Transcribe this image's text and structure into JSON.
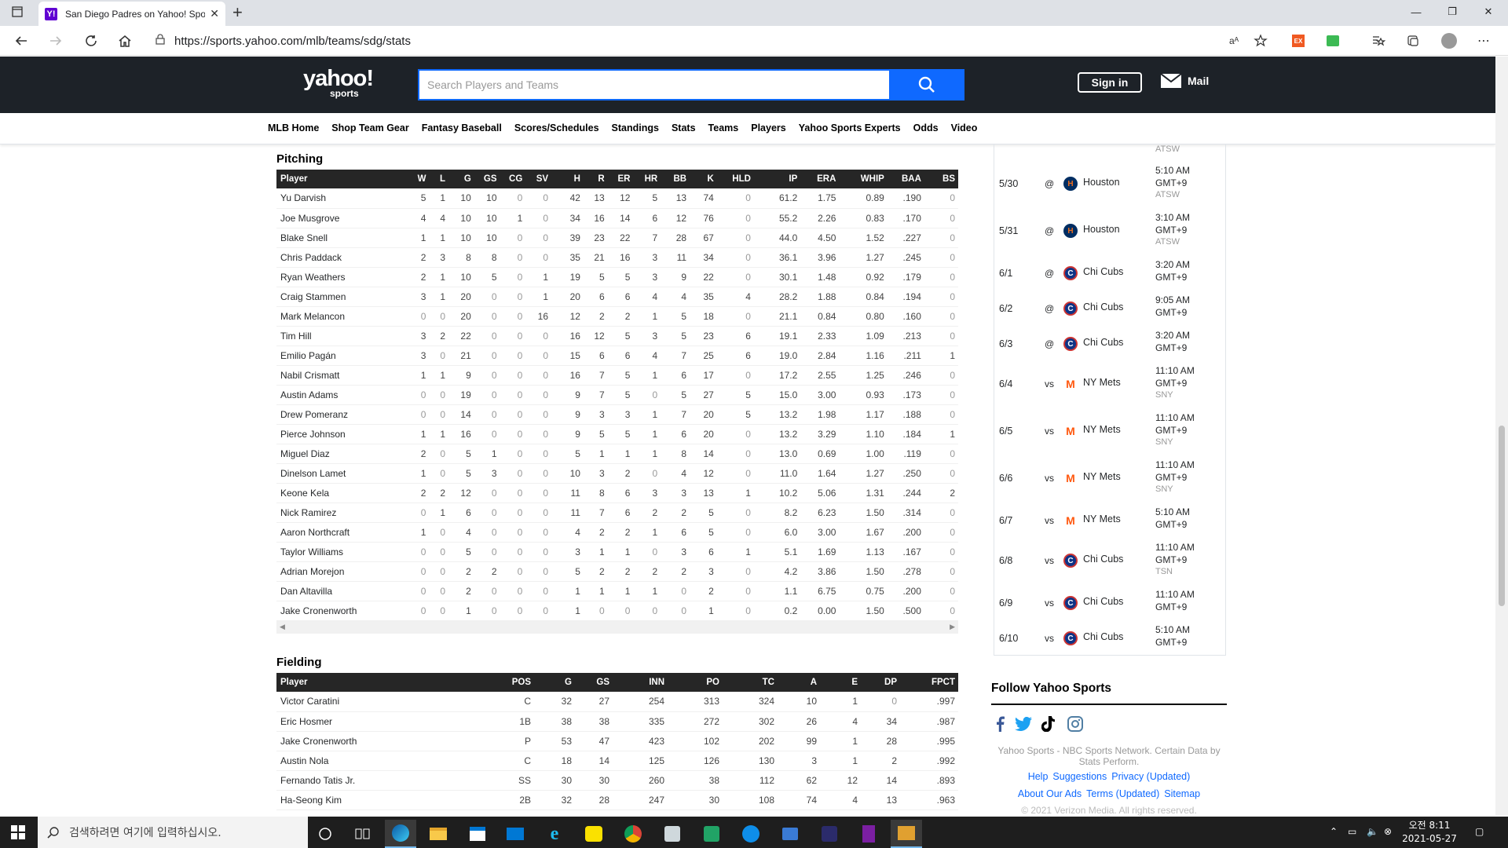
{
  "browser": {
    "tab_title": "San Diego Padres on Yahoo! Spo",
    "url": "https://sports.yahoo.com/mlb/teams/sdg/stats",
    "ext_label": "EX",
    "reader_label": "aᴬ"
  },
  "yahoo": {
    "logo_main": "yahoo!",
    "logo_sub": "sports",
    "search_placeholder": "Search Players and Teams",
    "sign_in": "Sign in",
    "mail": "Mail",
    "nav": [
      "MLB Home",
      "Shop Team Gear",
      "Fantasy Baseball",
      "Scores/Schedules",
      "Standings",
      "Stats",
      "Teams",
      "Players",
      "Yahoo Sports Experts",
      "Odds",
      "Video"
    ]
  },
  "pitching": {
    "title": "Pitching",
    "headers": [
      "Player",
      "W",
      "L",
      "G",
      "GS",
      "CG",
      "SV",
      "H",
      "R",
      "ER",
      "HR",
      "BB",
      "K",
      "HLD",
      "IP",
      "ERA",
      "WHIP",
      "BAA",
      "BS"
    ],
    "rows": [
      [
        "Yu Darvish",
        "5",
        "1",
        "10",
        "10",
        "0",
        "0",
        "42",
        "13",
        "12",
        "5",
        "13",
        "74",
        "0",
        "61.2",
        "1.75",
        "0.89",
        ".190",
        "0"
      ],
      [
        "Joe Musgrove",
        "4",
        "4",
        "10",
        "10",
        "1",
        "0",
        "34",
        "16",
        "14",
        "6",
        "12",
        "76",
        "0",
        "55.2",
        "2.26",
        "0.83",
        ".170",
        "0"
      ],
      [
        "Blake Snell",
        "1",
        "1",
        "10",
        "10",
        "0",
        "0",
        "39",
        "23",
        "22",
        "7",
        "28",
        "67",
        "0",
        "44.0",
        "4.50",
        "1.52",
        ".227",
        "0"
      ],
      [
        "Chris Paddack",
        "2",
        "3",
        "8",
        "8",
        "0",
        "0",
        "35",
        "21",
        "16",
        "3",
        "11",
        "34",
        "0",
        "36.1",
        "3.96",
        "1.27",
        ".245",
        "0"
      ],
      [
        "Ryan Weathers",
        "2",
        "1",
        "10",
        "5",
        "0",
        "1",
        "19",
        "5",
        "5",
        "3",
        "9",
        "22",
        "0",
        "30.1",
        "1.48",
        "0.92",
        ".179",
        "0"
      ],
      [
        "Craig Stammen",
        "3",
        "1",
        "20",
        "0",
        "0",
        "1",
        "20",
        "6",
        "6",
        "4",
        "4",
        "35",
        "4",
        "28.2",
        "1.88",
        "0.84",
        ".194",
        "0"
      ],
      [
        "Mark Melancon",
        "0",
        "0",
        "20",
        "0",
        "0",
        "16",
        "12",
        "2",
        "2",
        "1",
        "5",
        "18",
        "0",
        "21.1",
        "0.84",
        "0.80",
        ".160",
        "0"
      ],
      [
        "Tim Hill",
        "3",
        "2",
        "22",
        "0",
        "0",
        "0",
        "16",
        "12",
        "5",
        "3",
        "5",
        "23",
        "6",
        "19.1",
        "2.33",
        "1.09",
        ".213",
        "0"
      ],
      [
        "Emilio Pagán",
        "3",
        "0",
        "21",
        "0",
        "0",
        "0",
        "15",
        "6",
        "6",
        "4",
        "7",
        "25",
        "6",
        "19.0",
        "2.84",
        "1.16",
        ".211",
        "1"
      ],
      [
        "Nabil Crismatt",
        "1",
        "1",
        "9",
        "0",
        "0",
        "0",
        "16",
        "7",
        "5",
        "1",
        "6",
        "17",
        "0",
        "17.2",
        "2.55",
        "1.25",
        ".246",
        "0"
      ],
      [
        "Austin Adams",
        "0",
        "0",
        "19",
        "0",
        "0",
        "0",
        "9",
        "7",
        "5",
        "0",
        "5",
        "27",
        "5",
        "15.0",
        "3.00",
        "0.93",
        ".173",
        "0"
      ],
      [
        "Drew Pomeranz",
        "0",
        "0",
        "14",
        "0",
        "0",
        "0",
        "9",
        "3",
        "3",
        "1",
        "7",
        "20",
        "5",
        "13.2",
        "1.98",
        "1.17",
        ".188",
        "0"
      ],
      [
        "Pierce Johnson",
        "1",
        "1",
        "16",
        "0",
        "0",
        "0",
        "9",
        "5",
        "5",
        "1",
        "6",
        "20",
        "0",
        "13.2",
        "3.29",
        "1.10",
        ".184",
        "1"
      ],
      [
        "Miguel Diaz",
        "2",
        "0",
        "5",
        "1",
        "0",
        "0",
        "5",
        "1",
        "1",
        "1",
        "8",
        "14",
        "0",
        "13.0",
        "0.69",
        "1.00",
        ".119",
        "0"
      ],
      [
        "Dinelson Lamet",
        "1",
        "0",
        "5",
        "3",
        "0",
        "0",
        "10",
        "3",
        "2",
        "0",
        "4",
        "12",
        "0",
        "11.0",
        "1.64",
        "1.27",
        ".250",
        "0"
      ],
      [
        "Keone Kela",
        "2",
        "2",
        "12",
        "0",
        "0",
        "0",
        "11",
        "8",
        "6",
        "3",
        "3",
        "13",
        "1",
        "10.2",
        "5.06",
        "1.31",
        ".244",
        "2"
      ],
      [
        "Nick Ramirez",
        "0",
        "1",
        "6",
        "0",
        "0",
        "0",
        "11",
        "7",
        "6",
        "2",
        "2",
        "5",
        "0",
        "8.2",
        "6.23",
        "1.50",
        ".314",
        "0"
      ],
      [
        "Aaron Northcraft",
        "1",
        "0",
        "4",
        "0",
        "0",
        "0",
        "4",
        "2",
        "2",
        "1",
        "6",
        "5",
        "0",
        "6.0",
        "3.00",
        "1.67",
        ".200",
        "0"
      ],
      [
        "Taylor Williams",
        "0",
        "0",
        "5",
        "0",
        "0",
        "0",
        "3",
        "1",
        "1",
        "0",
        "3",
        "6",
        "1",
        "5.1",
        "1.69",
        "1.13",
        ".167",
        "0"
      ],
      [
        "Adrian Morejon",
        "0",
        "0",
        "2",
        "2",
        "0",
        "0",
        "5",
        "2",
        "2",
        "2",
        "2",
        "3",
        "0",
        "4.2",
        "3.86",
        "1.50",
        ".278",
        "0"
      ],
      [
        "Dan Altavilla",
        "0",
        "0",
        "2",
        "0",
        "0",
        "0",
        "1",
        "1",
        "1",
        "1",
        "0",
        "2",
        "0",
        "1.1",
        "6.75",
        "0.75",
        ".200",
        "0"
      ],
      [
        "Jake Cronenworth",
        "0",
        "0",
        "1",
        "0",
        "0",
        "0",
        "1",
        "0",
        "0",
        "0",
        "0",
        "1",
        "0",
        "0.2",
        "0.00",
        "1.50",
        ".500",
        "0"
      ]
    ]
  },
  "fielding": {
    "title": "Fielding",
    "headers": [
      "Player",
      "POS",
      "G",
      "GS",
      "INN",
      "PO",
      "TC",
      "A",
      "E",
      "DP",
      "FPCT"
    ],
    "rows": [
      [
        "Victor Caratini",
        "C",
        "32",
        "27",
        "254",
        "313",
        "324",
        "10",
        "1",
        "0",
        ".997"
      ],
      [
        "Eric Hosmer",
        "1B",
        "38",
        "38",
        "335",
        "272",
        "302",
        "26",
        "4",
        "34",
        ".987"
      ],
      [
        "Jake Cronenworth",
        "P",
        "53",
        "47",
        "423",
        "102",
        "202",
        "99",
        "1",
        "28",
        ".995"
      ],
      [
        "Austin Nola",
        "C",
        "18",
        "14",
        "125",
        "126",
        "130",
        "3",
        "1",
        "2",
        ".992"
      ],
      [
        "Fernando Tatis Jr.",
        "SS",
        "30",
        "30",
        "260",
        "38",
        "112",
        "62",
        "12",
        "14",
        ".893"
      ],
      [
        "Ha-Seong Kim",
        "2B",
        "32",
        "28",
        "247",
        "30",
        "108",
        "74",
        "4",
        "13",
        ".963"
      ]
    ]
  },
  "schedule": {
    "top_network": "ATSW",
    "games": [
      {
        "date": "5/30",
        "ha": "@",
        "team": "Houston",
        "logo": "hou",
        "t1": "5:10 AM",
        "t2": "GMT+9",
        "net": "ATSW"
      },
      {
        "date": "5/31",
        "ha": "@",
        "team": "Houston",
        "logo": "hou",
        "t1": "3:10 AM",
        "t2": "GMT+9",
        "net": "ATSW"
      },
      {
        "date": "6/1",
        "ha": "@",
        "team": "Chi Cubs",
        "logo": "chc",
        "t1": "3:20 AM",
        "t2": "GMT+9",
        "net": ""
      },
      {
        "date": "6/2",
        "ha": "@",
        "team": "Chi Cubs",
        "logo": "chc",
        "t1": "9:05 AM",
        "t2": "GMT+9",
        "net": ""
      },
      {
        "date": "6/3",
        "ha": "@",
        "team": "Chi Cubs",
        "logo": "chc",
        "t1": "3:20 AM",
        "t2": "GMT+9",
        "net": ""
      },
      {
        "date": "6/4",
        "ha": "vs",
        "team": "NY Mets",
        "logo": "nym",
        "t1": "11:10 AM",
        "t2": "GMT+9",
        "net": "SNY"
      },
      {
        "date": "6/5",
        "ha": "vs",
        "team": "NY Mets",
        "logo": "nym",
        "t1": "11:10 AM",
        "t2": "GMT+9",
        "net": "SNY"
      },
      {
        "date": "6/6",
        "ha": "vs",
        "team": "NY Mets",
        "logo": "nym",
        "t1": "11:10 AM",
        "t2": "GMT+9",
        "net": "SNY"
      },
      {
        "date": "6/7",
        "ha": "vs",
        "team": "NY Mets",
        "logo": "nym",
        "t1": "5:10 AM",
        "t2": "GMT+9",
        "net": ""
      },
      {
        "date": "6/8",
        "ha": "vs",
        "team": "Chi Cubs",
        "logo": "chc",
        "t1": "11:10 AM",
        "t2": "GMT+9",
        "net": "TSN"
      },
      {
        "date": "6/9",
        "ha": "vs",
        "team": "Chi Cubs",
        "logo": "chc",
        "t1": "11:10 AM",
        "t2": "GMT+9",
        "net": ""
      },
      {
        "date": "6/10",
        "ha": "vs",
        "team": "Chi Cubs",
        "logo": "chc",
        "t1": "5:10 AM",
        "t2": "GMT+9",
        "net": ""
      }
    ]
  },
  "follow": {
    "title": "Follow Yahoo Sports",
    "credit": "Yahoo Sports - NBC Sports Network. Certain Data by Stats Perform.",
    "links1": [
      "Help",
      "Suggestions",
      "Privacy (Updated)"
    ],
    "links2": [
      "About Our Ads",
      "Terms (Updated)",
      "Sitemap"
    ],
    "copyright": "© 2021 Verizon Media. All rights reserved."
  },
  "taskbar": {
    "search_placeholder": "검색하려면 여기에 입력하십시오.",
    "time": "오전 8:11",
    "date": "2021-05-27"
  },
  "colors": {
    "yahoo_header": "#1d2228",
    "yahoo_blue": "#0f69ff",
    "table_header": "#262626"
  }
}
